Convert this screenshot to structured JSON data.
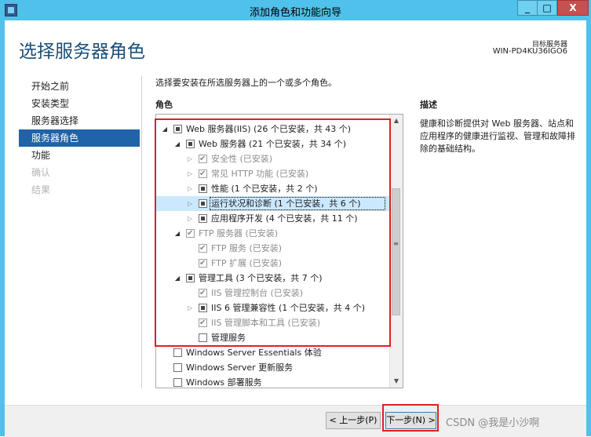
{
  "window": {
    "title": "添加角色和功能向导",
    "min_glyph": "_",
    "max_glyph": "□",
    "close_glyph": "X"
  },
  "header": {
    "page_title": "选择服务器角色",
    "target_label": "目标服务器",
    "target_name": "WIN-PD4KU36IGO6"
  },
  "nav": {
    "items": [
      {
        "label": "开始之前",
        "state": "normal"
      },
      {
        "label": "安装类型",
        "state": "normal"
      },
      {
        "label": "服务器选择",
        "state": "normal"
      },
      {
        "label": "服务器角色",
        "state": "active"
      },
      {
        "label": "功能",
        "state": "normal"
      },
      {
        "label": "确认",
        "state": "disabled"
      },
      {
        "label": "结果",
        "state": "disabled"
      }
    ]
  },
  "main": {
    "instruction": "选择要安装在所选服务器上的一个或多个角色。",
    "roles_label": "角色",
    "roles": [
      {
        "label": "Web 服务器(IIS) (26 个已安装，共 43 个)",
        "expander": "open",
        "check": "partial",
        "dim": false,
        "selected": false
      },
      {
        "label": "Web 服务器 (21 个已安装，共 34 个)",
        "expander": "open",
        "check": "partial",
        "dim": false,
        "selected": false
      },
      {
        "label": "安全性 (已安装)",
        "expander": "closed",
        "check": "checked",
        "dim": true,
        "selected": false
      },
      {
        "label": "常见 HTTP 功能 (已安装)",
        "expander": "closed",
        "check": "checked",
        "dim": true,
        "selected": false
      },
      {
        "label": "性能 (1 个已安装，共 2 个)",
        "expander": "closed",
        "check": "partial",
        "dim": false,
        "selected": false
      },
      {
        "label": "运行状况和诊断 (1 个已安装，共 6 个)",
        "expander": "closed",
        "check": "partial",
        "dim": false,
        "selected": true
      },
      {
        "label": "应用程序开发 (4 个已安装，共 11 个)",
        "expander": "closed",
        "check": "partial",
        "dim": false,
        "selected": false
      },
      {
        "label": "FTP 服务器 (已安装)",
        "expander": "open",
        "check": "checked",
        "dim": true,
        "selected": false
      },
      {
        "label": "FTP 服务 (已安装)",
        "expander": "none",
        "check": "checked",
        "dim": true,
        "selected": false
      },
      {
        "label": "FTP 扩展 (已安装)",
        "expander": "none",
        "check": "checked",
        "dim": true,
        "selected": false
      },
      {
        "label": "管理工具 (3 个已安装，共 7 个)",
        "expander": "open",
        "check": "partial",
        "dim": false,
        "selected": false
      },
      {
        "label": "IIS 管理控制台 (已安装)",
        "expander": "none",
        "check": "checked",
        "dim": true,
        "selected": false
      },
      {
        "label": "IIS 6 管理兼容性 (1 个已安装，共 4 个)",
        "expander": "closed",
        "check": "partial",
        "dim": false,
        "selected": false
      },
      {
        "label": "IIS 管理脚本和工具 (已安装)",
        "expander": "none",
        "check": "checked",
        "dim": true,
        "selected": false
      },
      {
        "label": "管理服务",
        "expander": "none",
        "check": "empty",
        "dim": false,
        "selected": false
      },
      {
        "label": "Windows Server Essentials 体验",
        "expander": "none",
        "check": "empty",
        "dim": false,
        "selected": false
      },
      {
        "label": "Windows Server 更新服务",
        "expander": "none",
        "check": "empty",
        "dim": false,
        "selected": false
      },
      {
        "label": "Windows 部署服务",
        "expander": "none",
        "check": "empty",
        "dim": false,
        "selected": false
      }
    ],
    "description_label": "描述",
    "description": "健康和诊断提供对 Web 服务器、站点和应用程序的健康进行监视、管理和故障排除的基础结构。"
  },
  "footer": {
    "prev_label": "< 上一步(P)",
    "next_label": "下一步(N) >",
    "watermark": "CSDN @我是小沙啊"
  },
  "icons": {
    "expander_open": "◢",
    "expander_closed": "▷",
    "scroll_up": "▲",
    "scroll_down": "▼",
    "scroll_grip": "≡"
  }
}
